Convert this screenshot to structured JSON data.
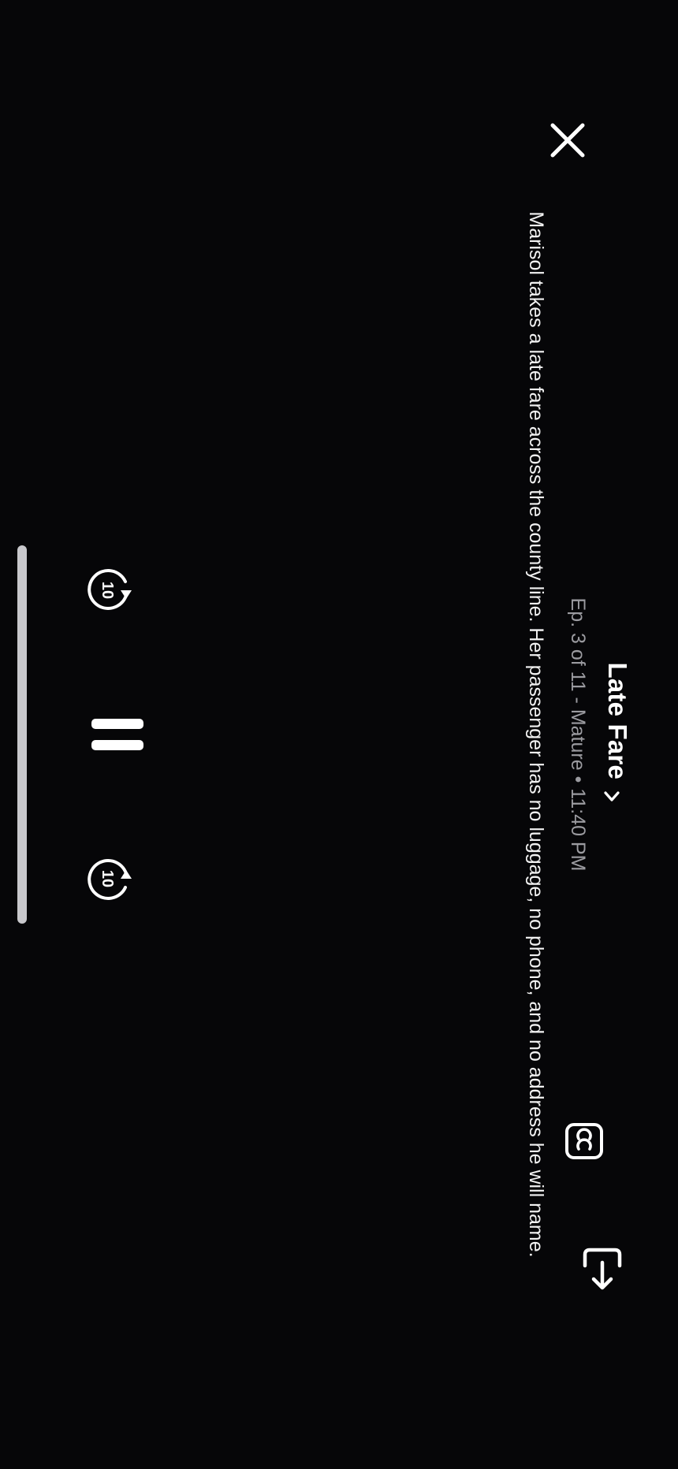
{
  "player": {
    "title": "Late Fare",
    "meta": "Ep. 3 of 11 - Mature • 11:40 PM",
    "synopsis": "Marisol takes a late fare across the county line. Her passenger has no luggage, no phone, and no address he will name."
  },
  "controls": {
    "skip_back_seconds": "10",
    "skip_forward_seconds": "10"
  },
  "icons": {
    "close": "close-icon",
    "title_chevron": "chevron-right-icon",
    "captions": "closed-captions-icon",
    "share": "share-icon",
    "rewind": "rewind-10-icon",
    "pause": "pause-icon",
    "forward": "forward-10-icon"
  },
  "colors": {
    "background": "#060608",
    "text": "#ffffff",
    "meta_text": "#9b9ba0",
    "scrubber": "#c8c8cc"
  }
}
